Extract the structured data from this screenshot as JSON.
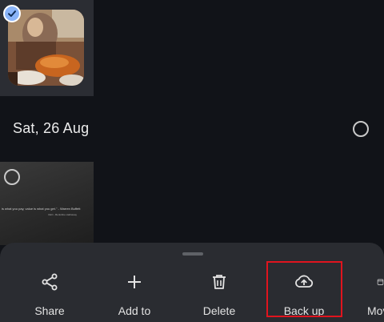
{
  "groups": [
    {
      "photos": [
        {
          "selected": true
        }
      ]
    },
    {
      "date": "Sat, 26 Aug",
      "photos": [
        {
          "selected": false,
          "quote": "is what you pay, value is what you get.\" - Warren Buffett",
          "quote_attrib": "CEO - Berkshire Hathaway"
        }
      ]
    }
  ],
  "action_sheet": {
    "actions": [
      {
        "label": "Share",
        "icon": "share-icon"
      },
      {
        "label": "Add to",
        "icon": "plus-icon"
      },
      {
        "label": "Delete",
        "icon": "trash-icon"
      },
      {
        "label": "Back up",
        "icon": "cloud-upload-icon"
      },
      {
        "label": "Move",
        "icon": "move-icon"
      }
    ]
  },
  "colors": {
    "background": "#111318",
    "sheet": "#2a2c31",
    "selection_accent": "#8ab4f8",
    "highlight": "#e0141e"
  }
}
